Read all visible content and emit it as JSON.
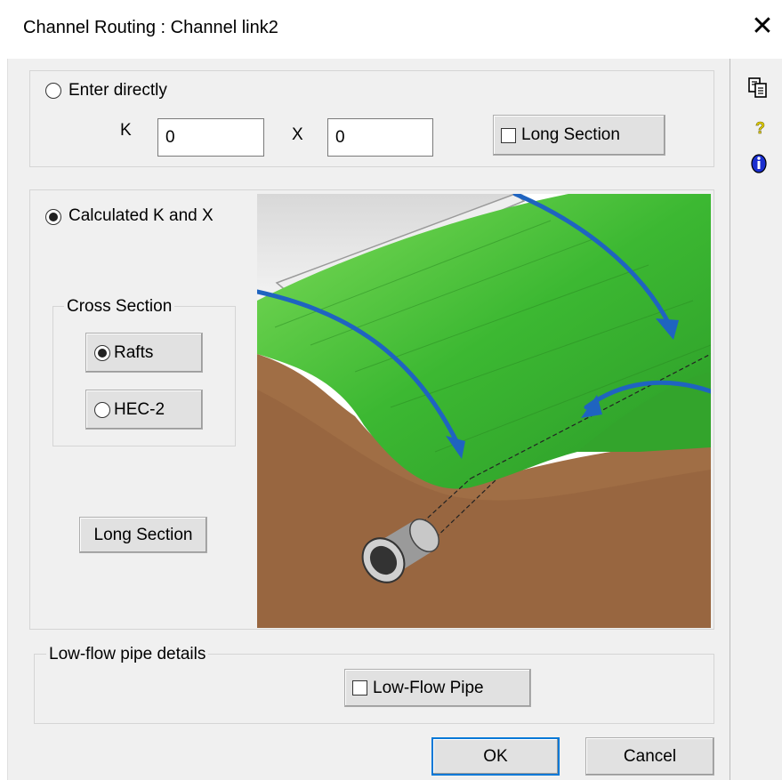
{
  "window": {
    "title": "Channel Routing : Channel link2",
    "close_glyph": "✕"
  },
  "enter_directly": {
    "label": "Enter directly",
    "selected": false,
    "k_label": "K",
    "k_value": "0",
    "x_label": "X",
    "x_value": "0",
    "long_section_label": "Long Section",
    "long_section_checked": false
  },
  "calculated": {
    "label": "Calculated K and X",
    "selected": true,
    "cross_section": {
      "group_label": "Cross Section",
      "options": [
        {
          "label": "Rafts",
          "selected": true
        },
        {
          "label": "HEC-2",
          "selected": false
        }
      ]
    },
    "long_section_button": "Long Section"
  },
  "low_flow": {
    "group_label": "Low-flow pipe details",
    "pipe_label": "Low-Flow Pipe",
    "pipe_checked": false
  },
  "buttons": {
    "ok": "OK",
    "cancel": "Cancel"
  },
  "side_icons": [
    "copy-icon",
    "help-icon",
    "info-icon"
  ],
  "colors": {
    "grass": "#3cb832",
    "soil": "#9a6a42",
    "arrow": "#1f64c0",
    "accent": "#0078d7"
  }
}
